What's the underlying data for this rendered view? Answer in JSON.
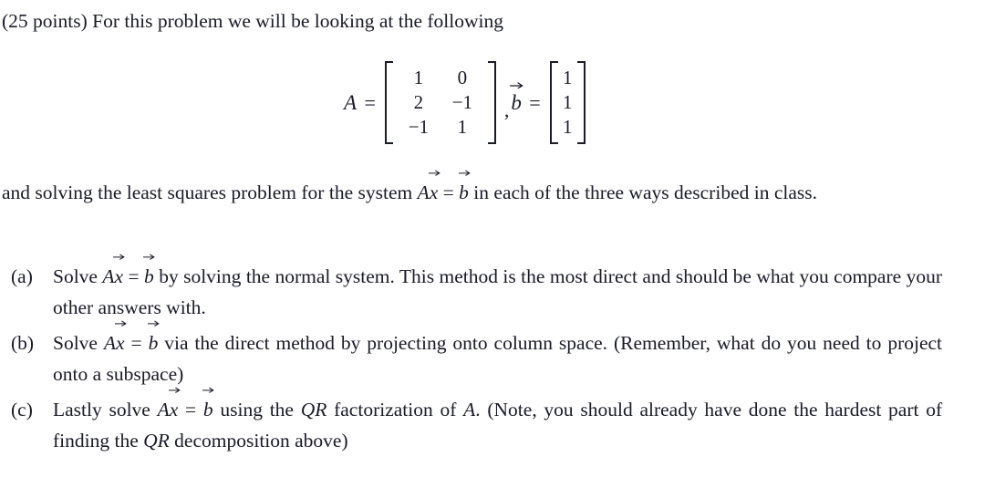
{
  "document": {
    "intro": "(25 points) For this problem we will be looking at the following",
    "equation": {
      "matrix_label": "A",
      "equals": "=",
      "matrix_A": [
        [
          "1",
          "0"
        ],
        [
          "2",
          "−1"
        ],
        [
          "−1",
          "1"
        ]
      ],
      "separator": ",",
      "vector_label": "b",
      "vector_b": [
        "1",
        "1",
        "1"
      ]
    },
    "paragraph_after_equation": {
      "before_math": "and solving the least squares problem for the system",
      "math_A": "A",
      "math_x": "x",
      "math_equals": "=",
      "math_b": "b",
      "after_math": "in each of the three ways described in class."
    },
    "items": [
      {
        "label": "(a)",
        "before_math": "Solve",
        "math_A": "A",
        "math_x": "x",
        "math_equals": "=",
        "math_b": "b",
        "after_math": "by solving the normal system. This method is the most direct and should be what you compare your other answers with."
      },
      {
        "label": "(b)",
        "before_math": "Solve",
        "math_A": "A",
        "math_x": "x",
        "math_equals": "=",
        "math_b": "b",
        "after_math": "via the direct method by projecting onto column space. (Remember, what do you need to project onto a subspace)"
      },
      {
        "label": "(c)",
        "before_math": "Lastly solve",
        "math_A": "A",
        "math_x": "x",
        "math_equals": "=",
        "math_b": "b",
        "mid_1": "using the",
        "math_QR_1": "QR",
        "mid_2": "factorization of",
        "math_A2": "A",
        "mid_3": ". (Note, you should already have done the hardest part of finding the",
        "math_QR_2": "QR",
        "mid_4": "decomposition above)"
      }
    ]
  },
  "colors": {
    "text": "#1a1a28",
    "background": "#ffffff"
  }
}
